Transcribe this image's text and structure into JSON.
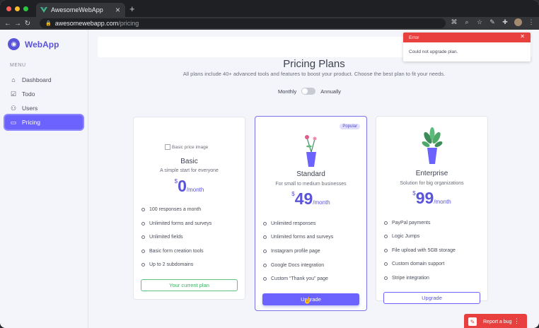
{
  "browser": {
    "tab_title": "AwesomeWebApp",
    "url_host": "awesomewebapp.com",
    "url_path": "/pricing",
    "traffic_colors": [
      "#ff5f57",
      "#febc2e",
      "#28c840"
    ]
  },
  "sidebar": {
    "brand": "WebApp",
    "menu_label": "MENU",
    "items": [
      {
        "label": "Dashboard",
        "icon": "home-icon",
        "active": false
      },
      {
        "label": "Todo",
        "icon": "checkbox-icon",
        "active": false
      },
      {
        "label": "Users",
        "icon": "user-icon",
        "active": false
      },
      {
        "label": "Pricing",
        "icon": "card-icon",
        "active": true
      }
    ]
  },
  "pricing": {
    "title": "Pricing Plans",
    "subtitle": "All plans include 40+ advanced tools and features to boost your product. Choose the best plan to fit your needs.",
    "toggle_left": "Monthly",
    "toggle_right": "Annually",
    "plans": [
      {
        "image_alt": "Basic price image",
        "name": "Basic",
        "desc": "A simple start for everyone",
        "currency": "$",
        "price": "0",
        "period": "/month",
        "features": [
          "100 responses a month",
          "Unlimited forms and surveys",
          "Unlimited fields",
          "Basic form creation tools",
          "Up to 2 subdomains"
        ],
        "button": "Your current plan"
      },
      {
        "badge": "Popular",
        "name": "Standard",
        "desc": "For small to medium businesses",
        "currency": "$",
        "price": "49",
        "period": "/month",
        "features": [
          "Unlimited responses",
          "Unlimited forms and surveys",
          "Instagram profile page",
          "Google Docs integration",
          "Custom “Thank you” page"
        ],
        "button": "Upgrade"
      },
      {
        "name": "Enterprise",
        "desc": "Solution for big organizations",
        "currency": "$",
        "price": "99",
        "period": "/month",
        "features": [
          "PayPal payments",
          "Logic Jumps",
          "File upload with 5GB storage",
          "Custom domain support",
          "Stripe integration"
        ],
        "button": "Upgrade"
      }
    ]
  },
  "toast": {
    "title": "Error",
    "message": "Could not upgrade plan."
  },
  "bug_button": "Report a bug",
  "colors": {
    "accent": "#6c63ff",
    "error": "#e8403e",
    "success": "#3fae63"
  }
}
